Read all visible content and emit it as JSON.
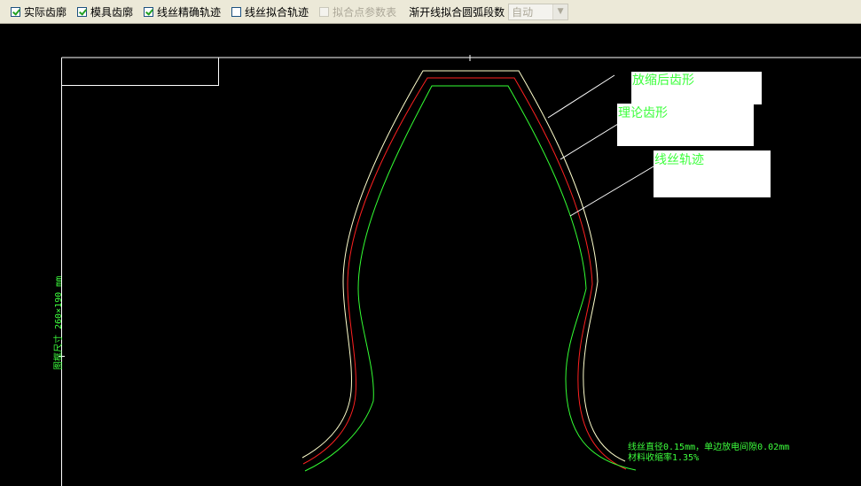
{
  "toolbar": {
    "items": [
      {
        "label": "实际齿廓",
        "checked": true,
        "disabled": false
      },
      {
        "label": "模具齿廓",
        "checked": true,
        "disabled": false
      },
      {
        "label": "线丝精确轨迹",
        "checked": true,
        "disabled": false
      },
      {
        "label": "线丝拟合轨迹",
        "checked": false,
        "disabled": false
      },
      {
        "label": "拟合点参数表",
        "checked": false,
        "disabled": true
      }
    ],
    "arc_segments_label": "渐开线拟合圆弧段数",
    "arc_segments_value": "自动"
  },
  "canvas": {
    "labels": {
      "scaled_profile": "放缩后齿形",
      "theory_profile": "理论齿形",
      "wire_path": "线丝轨迹"
    },
    "frame_size_label": "图框尺寸  260×190 mm",
    "notes": {
      "line1": "线丝直径0.15mm，单边放电间隙0.02mm",
      "line2": "材料收缩率1.35%"
    },
    "colors": {
      "background": "#000000",
      "scaled_curve": "#ffffcc",
      "theory_curve": "#ff2020",
      "wire_curve": "#33ff33",
      "label_text": "#3dff3d",
      "frame": "#ffffff"
    }
  }
}
